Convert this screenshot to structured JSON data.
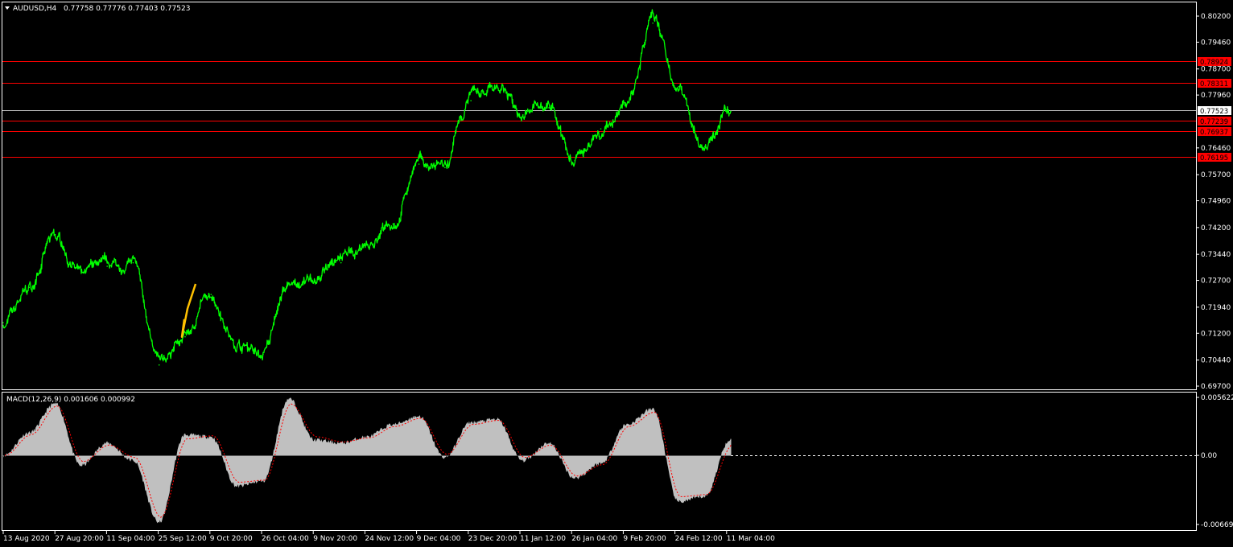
{
  "window": {
    "symbol_timeframe": "AUDUSD,H4",
    "ohlc": "0.77758 0.77776 0.77403 0.77523",
    "collapse_arrow_icon": "triangle-down-icon"
  },
  "colors": {
    "background": "#000000",
    "price_line": "#00ff00",
    "hline": "#ff0000",
    "current_price_line": "#c0c0c0",
    "highlight_segment": "#ffc000",
    "macd_histogram": "#c0c0c0",
    "macd_signal": "#ff0000",
    "grid_border": "#ffffff"
  },
  "chart_data": [
    {
      "type": "line",
      "title": "AUDUSD,H4",
      "price_axis": {
        "ylim": [
          0.697,
          0.802
        ],
        "ticks": [
          "0.80200",
          "0.79460",
          "0.78700",
          "0.77960",
          "0.76460",
          "0.75700",
          "0.74960",
          "0.74200",
          "0.73440",
          "0.72700",
          "0.71940",
          "0.71200",
          "0.70440",
          "0.69700"
        ]
      },
      "time_axis": {
        "ticks": [
          "13 Aug 2020",
          "27 Aug 20:00",
          "11 Sep 04:00",
          "25 Sep 12:00",
          "9 Oct 20:00",
          "26 Oct 04:00",
          "9 Nov 20:00",
          "24 Nov 12:00",
          "9 Dec 04:00",
          "23 Dec 20:00",
          "11 Jan 12:00",
          "26 Jan 04:00",
          "9 Feb 20:00",
          "24 Feb 12:00",
          "11 Mar 04:00"
        ]
      },
      "series": [
        {
          "x": [
            "13 Aug 2020",
            "20 Aug",
            "27 Aug 20:00",
            "4 Sep",
            "11 Sep 04:00",
            "18 Sep",
            "25 Sep 12:00",
            "2 Oct",
            "9 Oct 20:00",
            "17 Oct",
            "26 Oct 04:00",
            "2 Nov",
            "9 Nov 20:00",
            "17 Nov",
            "24 Nov 12:00",
            "1 Dec",
            "9 Dec 04:00",
            "16 Dec",
            "23 Dec 20:00",
            "1 Jan",
            "11 Jan 12:00",
            "19 Jan",
            "26 Jan 04:00",
            "2 Feb",
            "9 Feb 20:00",
            "17 Feb",
            "24 Feb 12:00",
            "3 Mar",
            "11 Mar 04:00"
          ],
          "values": [
            0.715,
            0.725,
            0.74,
            0.729,
            0.731,
            0.732,
            0.703,
            0.711,
            0.723,
            0.708,
            0.706,
            0.726,
            0.727,
            0.732,
            0.737,
            0.743,
            0.76,
            0.759,
            0.778,
            0.782,
            0.774,
            0.776,
            0.761,
            0.77,
            0.777,
            0.8,
            0.782,
            0.765,
            0.775
          ]
        }
      ],
      "highlight_segment": {
        "x": [
          "29 Sep",
          "1 Oct",
          "4 Oct"
        ],
        "values": [
          0.711,
          0.719,
          0.726
        ]
      },
      "horizontal_lines": [
        {
          "value": 0.78924,
          "label": "0.78924"
        },
        {
          "value": 0.78311,
          "label": "0.78311"
        },
        {
          "value": 0.77239,
          "label": "0.77239"
        },
        {
          "value": 0.76937,
          "label": "0.76937"
        },
        {
          "value": 0.76195,
          "label": "0.76195"
        }
      ],
      "current_price": {
        "value": 0.77523,
        "label": "0.77523"
      }
    },
    {
      "type": "bar",
      "title": "MACD(12,26,9) 0.001606 0.000992",
      "macd_axis": {
        "ylim": [
          -0.006695,
          0.005622
        ],
        "ticks": [
          "0.005622",
          "0.00",
          "-0.006695"
        ]
      },
      "series": [
        {
          "name": "MACD",
          "x": [
            "13 Aug 2020",
            "20 Aug",
            "27 Aug 20:00",
            "4 Sep",
            "11 Sep 04:00",
            "18 Sep",
            "25 Sep 12:00",
            "2 Oct",
            "9 Oct 20:00",
            "17 Oct",
            "26 Oct 04:00",
            "2 Nov",
            "9 Nov 20:00",
            "17 Nov",
            "24 Nov 12:00",
            "1 Dec",
            "9 Dec 04:00",
            "16 Dec",
            "23 Dec 20:00",
            "1 Jan",
            "11 Jan 12:00",
            "19 Jan",
            "26 Jan 04:00",
            "2 Feb",
            "9 Feb 20:00",
            "17 Feb",
            "24 Feb 12:00",
            "3 Mar",
            "11 Mar 04:00"
          ],
          "values": [
            0.0,
            0.0022,
            0.005,
            -0.001,
            0.0012,
            -0.0005,
            -0.0065,
            0.002,
            0.0018,
            -0.003,
            -0.0025,
            0.0055,
            0.0015,
            0.0012,
            0.0018,
            0.003,
            0.0038,
            -0.0002,
            0.0032,
            0.0035,
            -0.0005,
            0.0012,
            -0.0022,
            -0.0008,
            0.003,
            0.0045,
            -0.0045,
            -0.004,
            0.0016
          ]
        },
        {
          "name": "Signal",
          "values": [
            0.0,
            0.002,
            0.0048,
            -0.0006,
            0.001,
            -0.0002,
            -0.006,
            0.0016,
            0.0019,
            -0.0026,
            -0.0024,
            0.005,
            0.0018,
            0.0013,
            0.0017,
            0.0028,
            0.0036,
            0.0001,
            0.003,
            0.0034,
            -0.0002,
            0.001,
            -0.002,
            -0.0009,
            0.0028,
            0.0042,
            -0.004,
            -0.0038,
            0.001
          ]
        }
      ]
    }
  ]
}
